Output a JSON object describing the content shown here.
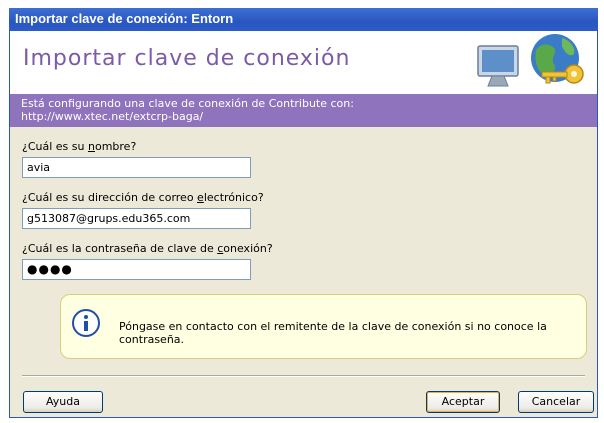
{
  "window": {
    "title": "Importar clave de conexión: Entorn"
  },
  "header": {
    "title": "Importar clave de conexión"
  },
  "info": {
    "line1": "Está configurando una clave de conexión de Contribute con:",
    "line2": "http://www.xtec.net/extcrp-baga/"
  },
  "form": {
    "name_label_pre": "¿Cuál es su ",
    "name_label_accel": "n",
    "name_label_post": "ombre?",
    "name_value": "avia",
    "email_label_pre": "¿Cuál es su dirección de correo ",
    "email_label_accel": "e",
    "email_label_post": "lectrónico?",
    "email_value": "g513087@grups.edu365.com",
    "password_label_pre": "¿Cuál es la contraseña de clave de ",
    "password_label_accel": "c",
    "password_label_post": "onexión?",
    "password_value": "●●●●"
  },
  "notice": {
    "icon": "info-icon",
    "text": "Póngase en contacto con el remitente de la clave de conexión si no conoce la contraseña."
  },
  "buttons": {
    "help": "Ayuda",
    "ok": "Aceptar",
    "cancel": "Cancelar"
  }
}
